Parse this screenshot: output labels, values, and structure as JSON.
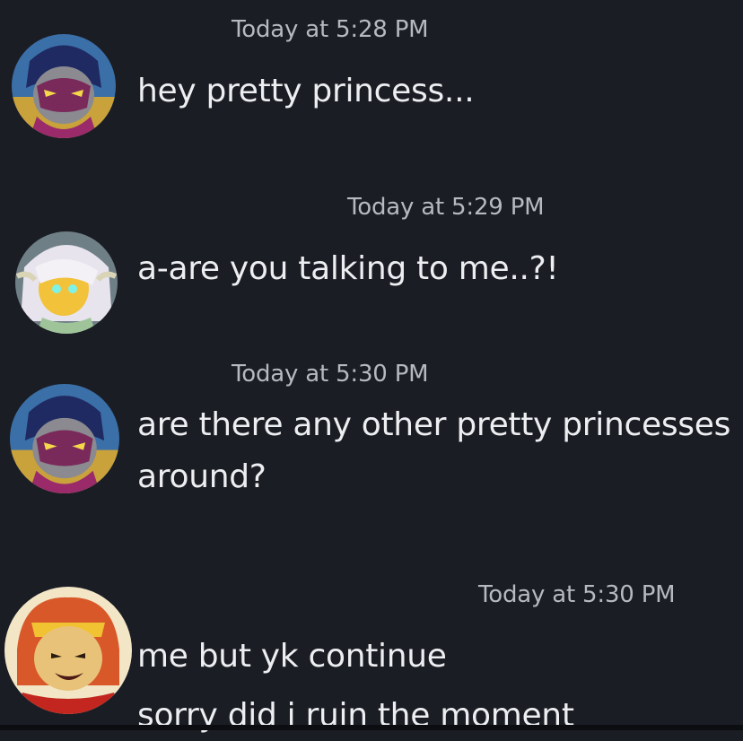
{
  "messages": [
    {
      "timestamp": "Today at 5:28 PM",
      "lines": [
        "hey pretty princess..."
      ],
      "avatar_icon": "masked-purple-villain-avatar"
    },
    {
      "timestamp": "Today at 5:29 PM",
      "lines": [
        "a-are you talking to me..?!"
      ],
      "avatar_icon": "white-haired-glowing-eyes-avatar"
    },
    {
      "timestamp": "Today at 5:30 PM",
      "lines": [
        "are there any other pretty princesses",
        "around?"
      ],
      "avatar_icon": "masked-purple-villain-avatar"
    },
    {
      "timestamp": "Today at 5:30 PM",
      "lines": [
        "me but yk continue",
        "sorry did i ruin the moment"
      ],
      "avatar_icon": "crowned-monkey-king-avatar"
    }
  ],
  "colors": {
    "background": "#1b1d24",
    "text": "#eceef1",
    "timestamp": "#b6b9c0"
  }
}
